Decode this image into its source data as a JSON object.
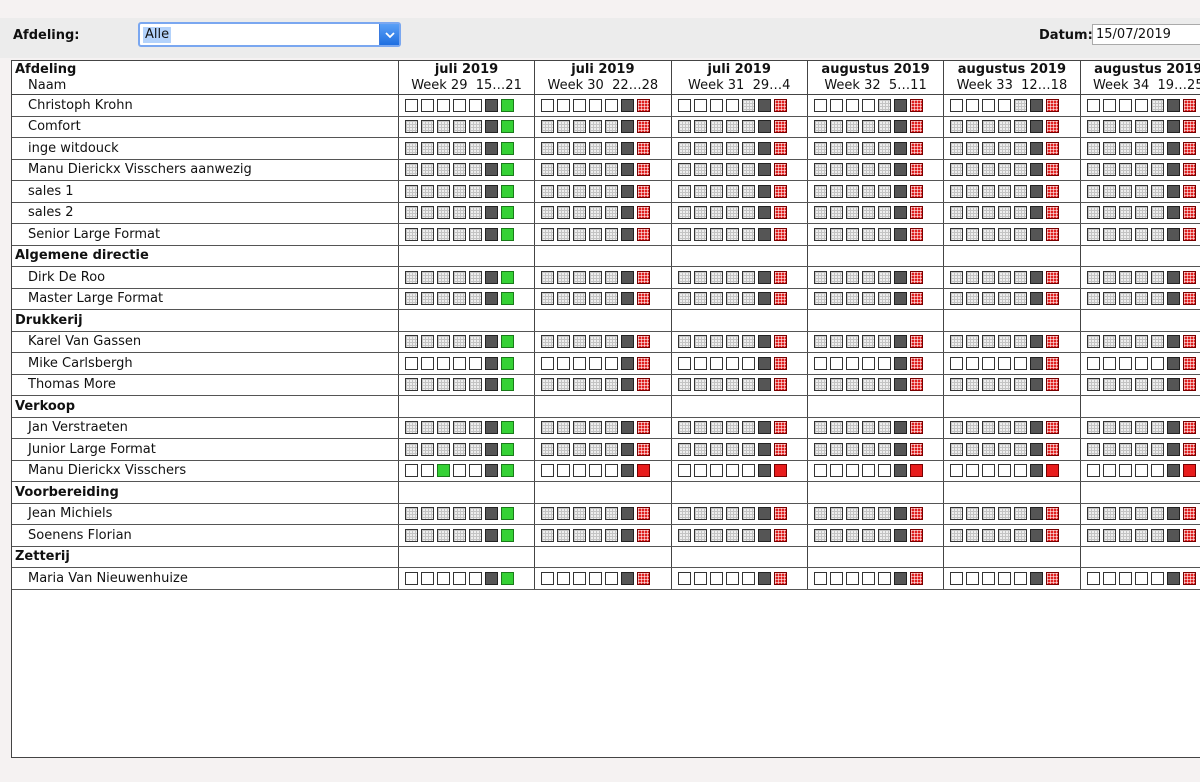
{
  "filter": {
    "label": "Afdeling:",
    "value": "Alle"
  },
  "datum": {
    "label": "Datum:",
    "value": "15/07/2019"
  },
  "header": {
    "col_afdeling": "Afdeling",
    "col_naam": "Naam"
  },
  "weeks": [
    {
      "month": "juli 2019",
      "week": "Week 29",
      "range": "15…21"
    },
    {
      "month": "juli 2019",
      "week": "Week 30",
      "range": "22…28"
    },
    {
      "month": "juli 2019",
      "week": "Week 31",
      "range": "29…4"
    },
    {
      "month": "augustus 2019",
      "week": "Week 32",
      "range": "5…11"
    },
    {
      "month": "augustus 2019",
      "week": "Week 33",
      "range": "12…18"
    },
    {
      "month": "augustus 2019",
      "week": "Week 34",
      "range": "19…25"
    }
  ],
  "rows": [
    {
      "type": "person",
      "name": "Christoph Krohn",
      "days": [
        "wwwwwdG",
        "wwwwwdr",
        "wwwwgdr",
        "wwwwgdr",
        "wwwwgdr",
        "wwwwgdr"
      ]
    },
    {
      "type": "person",
      "name": "Comfort",
      "days": [
        "ggggggdG",
        "ggggggdr",
        "ggggggdr",
        "ggggggdr",
        "ggggggdr",
        "ggggggdr"
      ]
    },
    {
      "type": "person",
      "name": "inge witdouck",
      "days": [
        "gggggdG",
        "gggggdr",
        "gggggdr",
        "gggggdr",
        "gggggdr",
        "gggggdr"
      ]
    },
    {
      "type": "person",
      "name": "Manu Dierickx Visschers aanwezig",
      "days": [
        "gggggdG",
        "gggggdr",
        "gggggdr",
        "gggggdr",
        "gggggdr",
        "gggggdr"
      ]
    },
    {
      "type": "person",
      "name": "sales 1",
      "days": [
        "gggggdG",
        "gggggdr",
        "gggggdr",
        "gggggdr",
        "gggggdr",
        "gggggdr"
      ]
    },
    {
      "type": "person",
      "name": "sales 2",
      "days": [
        "gggggdG",
        "gggggdr",
        "gggggdr",
        "gggggdr",
        "gggggdr",
        "gggggdr"
      ]
    },
    {
      "type": "person",
      "name": "Senior Large Format",
      "days": [
        "gggggdG",
        "gggggdr",
        "gggggdr",
        "gggggdr",
        "gggggdr",
        "gggggdr"
      ]
    },
    {
      "type": "dept",
      "name": "Algemene directie"
    },
    {
      "type": "person",
      "name": "Dirk De Roo",
      "days": [
        "gggggdG",
        "gggggdr",
        "gggggdr",
        "gggggdr",
        "gggggdr",
        "gggggdr"
      ]
    },
    {
      "type": "person",
      "name": "Master Large Format",
      "days": [
        "gggggdG",
        "gggggdr",
        "gggggdr",
        "gggggdr",
        "gggggdr",
        "gggggdr"
      ]
    },
    {
      "type": "dept",
      "name": "Drukkerij"
    },
    {
      "type": "person",
      "name": "Karel Van Gassen",
      "days": [
        "gggggdG",
        "gggggdr",
        "gggggdr",
        "gggggdr",
        "gggggdr",
        "gggggdr"
      ]
    },
    {
      "type": "person",
      "name": "Mike Carlsbergh",
      "days": [
        "wwwwwdG",
        "wwwwwdr",
        "wwwwwdr",
        "wwwwwdr",
        "wwwwwdr",
        "wwwwwdr"
      ]
    },
    {
      "type": "person",
      "name": "Thomas More",
      "days": [
        "gggggdG",
        "gggggdr",
        "gggggdr",
        "gggggdr",
        "gggggdr",
        "gggggdr"
      ]
    },
    {
      "type": "dept",
      "name": "Verkoop"
    },
    {
      "type": "person",
      "name": "Jan Verstraeten",
      "days": [
        "gggggdG",
        "gggggdr",
        "gggggdr",
        "gggggdr",
        "gggggdr",
        "gggggdr"
      ]
    },
    {
      "type": "person",
      "name": "Junior Large Format",
      "days": [
        "gggggdG",
        "gggggdr",
        "gggggdr",
        "gggggdr",
        "gggggdr",
        "gggggdr"
      ]
    },
    {
      "type": "person",
      "name": "Manu Dierickx Visschers",
      "days": [
        "wwGwwdG",
        "wwwwwdR",
        "wwwwwdR",
        "wwwwwdR",
        "wwwwwdR",
        "wwwwwdR"
      ]
    },
    {
      "type": "dept",
      "name": "Voorbereiding"
    },
    {
      "type": "person",
      "name": "Jean Michiels",
      "days": [
        "gggggdG",
        "gggggdr",
        "gggggdr",
        "gggggdr",
        "gggggdr",
        "gggggdr"
      ]
    },
    {
      "type": "person",
      "name": "Soenens Florian",
      "days": [
        "gggggdG",
        "gggggdr",
        "gggggdr",
        "gggggdr",
        "gggggdr",
        "gggggdr"
      ]
    },
    {
      "type": "dept",
      "name": "Zetterij"
    },
    {
      "type": "person",
      "name": "Maria Van Nieuwenhuize",
      "days": [
        "wwwwwdG",
        "wwwwwdr",
        "wwwwwdr",
        "wwwwwdr",
        "wwwwwdr",
        "wwwwwdr"
      ]
    }
  ],
  "legend_colors": {
    "w": "#ffffff",
    "g": "#eeeeee",
    "d": "#555555",
    "G": "#35d135",
    "r": "#e02020",
    "R": "#e81c1c"
  }
}
